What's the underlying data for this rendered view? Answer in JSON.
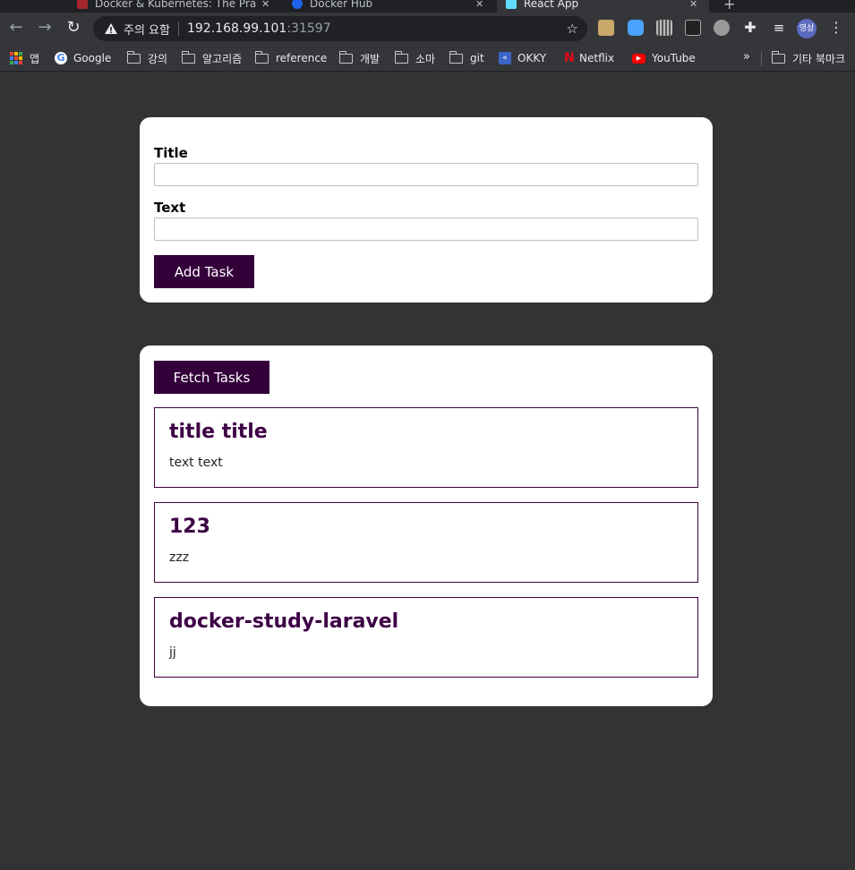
{
  "browser": {
    "tabs": [
      {
        "title": "Docker & Kubernetes: The Pra"
      },
      {
        "title": "Docker Hub"
      },
      {
        "title": "React App",
        "active": true
      }
    ],
    "address": {
      "warning": "주의 요함",
      "host": "192.168.99.101",
      "port": ":31597"
    },
    "profile_label": "영상",
    "bookmarks": [
      {
        "label": "앱",
        "icon": "apps-grid-icon"
      },
      {
        "label": "Google",
        "icon": "google-icon"
      },
      {
        "label": "강의",
        "icon": "folder-icon"
      },
      {
        "label": "알고리즘",
        "icon": "folder-icon"
      },
      {
        "label": "reference",
        "icon": "folder-icon"
      },
      {
        "label": "개발",
        "icon": "folder-icon"
      },
      {
        "label": "소마",
        "icon": "folder-icon"
      },
      {
        "label": "git",
        "icon": "folder-icon"
      },
      {
        "label": "OKKY",
        "icon": "okky-icon"
      },
      {
        "label": "Netflix",
        "icon": "netflix-icon"
      },
      {
        "label": "YouTube",
        "icon": "youtube-icon"
      }
    ],
    "other_bookmarks": "기타 북마크",
    "overflow": "»"
  },
  "form": {
    "title_label": "Title",
    "title_value": "",
    "text_label": "Text",
    "text_value": "",
    "add_button": "Add Task"
  },
  "tasks_section": {
    "fetch_button": "Fetch Tasks",
    "tasks": [
      {
        "title": "title title",
        "text": "text text"
      },
      {
        "title": "123",
        "text": "zzz"
      },
      {
        "title": "docker-study-laravel",
        "text": "jj"
      }
    ]
  },
  "colors": {
    "page_bg": "#333333",
    "button_bg": "#33003a",
    "task_title": "#3d0045",
    "task_border": "#3d0040"
  }
}
